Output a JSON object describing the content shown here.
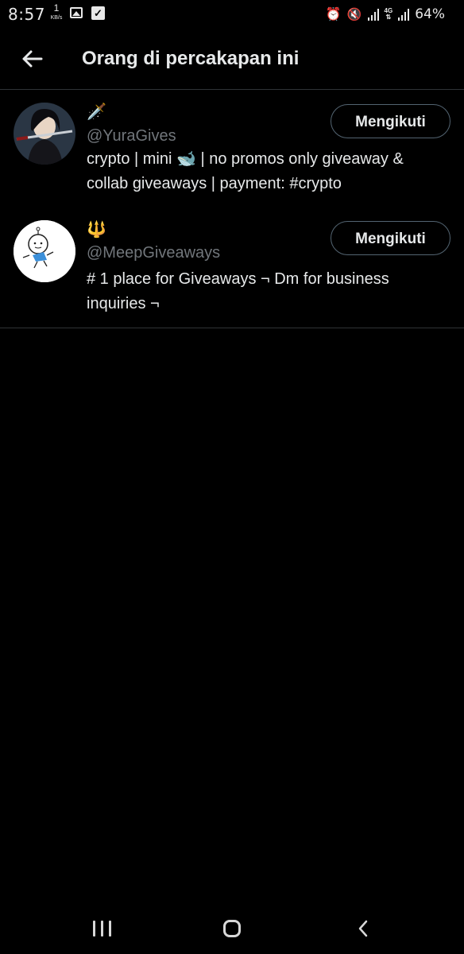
{
  "status_bar": {
    "time": "8:57",
    "net_speed": "1",
    "net_unit": "KB/s",
    "net_type": "4G",
    "battery": "64%"
  },
  "header": {
    "title": "Orang di percakapan ini"
  },
  "users": [
    {
      "display_name": "🗡️",
      "handle": "@YuraGives",
      "bio_line1": "crypto | mini 🐋 | no promos only giveaway &",
      "bio_line2": "collab giveaways | payment: #crypto",
      "follow_label": "Mengikuti"
    },
    {
      "display_name": "🔱",
      "handle": "@MeepGiveaways",
      "bio_line1": "# 1 place for Giveaways ¬ Dm for business",
      "bio_line2": "inquiries ¬",
      "follow_label": "Mengikuti"
    }
  ],
  "colors": {
    "background": "#000000",
    "text": "#e7e9ea",
    "handle": "#71767b",
    "border": "#2f3336"
  }
}
